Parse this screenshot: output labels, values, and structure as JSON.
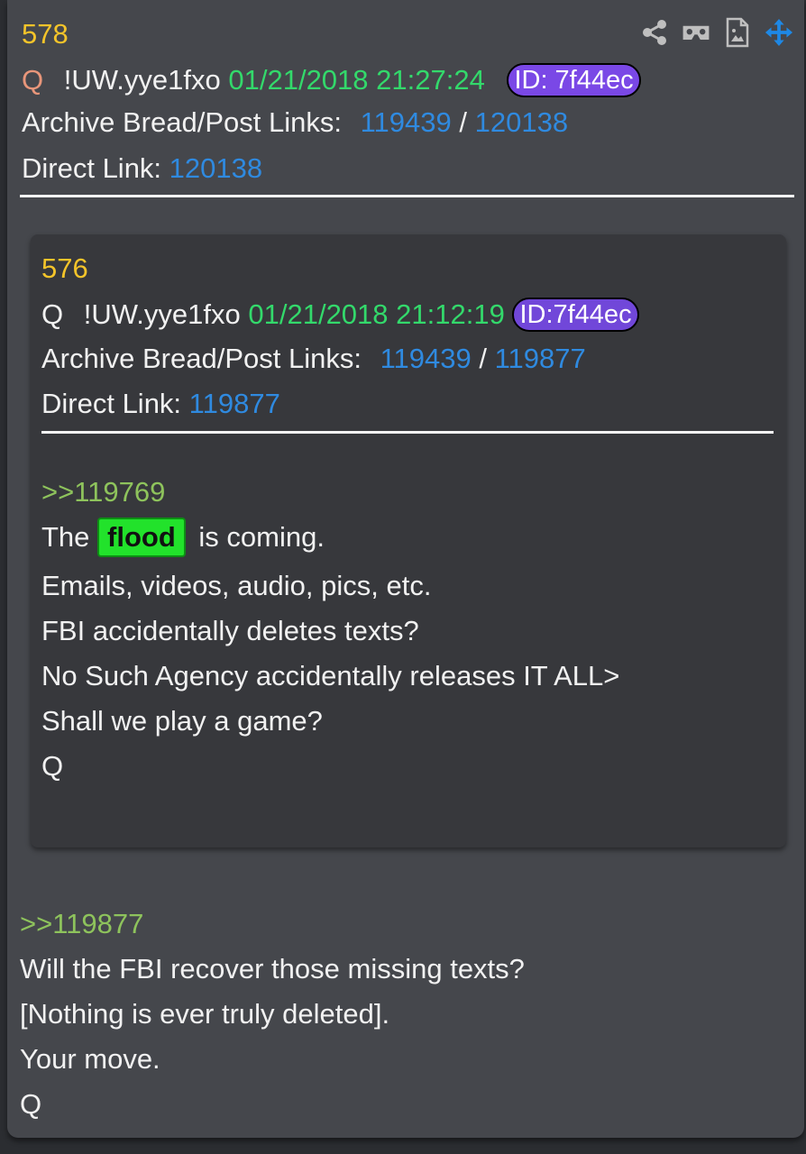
{
  "post": {
    "number": "578",
    "author": "Q",
    "tripcode": "!UW.yye1fxo",
    "datetime": "01/21/2018 21:27:24",
    "id": "ID: 7f44ec",
    "archive_label": "Archive Bread/Post Links:",
    "bread_link": "119439",
    "separator": "/",
    "post_link": "120138",
    "direct_label": "Direct Link:",
    "direct_link": "120138",
    "reply_ref": ">>119877",
    "lines": [
      "Will the FBI recover those missing texts?",
      "[Nothing is ever truly deleted].",
      "Your move.",
      "Q"
    ]
  },
  "quoted_post": {
    "number": "576",
    "author": "Q",
    "tripcode": "!UW.yye1fxo",
    "datetime": "01/21/2018 21:12:19",
    "id": "ID:7f44ec",
    "archive_label": "Archive Bread/Post Links:",
    "bread_link": "119439",
    "separator": "/",
    "post_link": "119877",
    "direct_label": "Direct Link:",
    "direct_link": "119877",
    "reply_ref": ">>119769",
    "line1_before": "The",
    "highlight": "flood",
    "line1_after": "is coming.",
    "lines": [
      "Emails, videos, audio, pics, etc.",
      "FBI accidentally deletes texts?",
      "No Such Agency accidentally releases IT ALL>",
      "Shall we play a game?",
      "Q"
    ]
  },
  "toolbar": {
    "icons": [
      "share-icon",
      "vr-viewer-icon",
      "document-image-icon",
      "move-icon"
    ]
  },
  "colors": {
    "post_number": "#f4c42a",
    "author": "#e8967a",
    "datetime": "#33d96b",
    "link": "#2f8ae0",
    "quote": "#8ec35c",
    "id_badge": "#7a48e6",
    "highlight": "#22e22b",
    "move_icon": "#1e88e5"
  }
}
